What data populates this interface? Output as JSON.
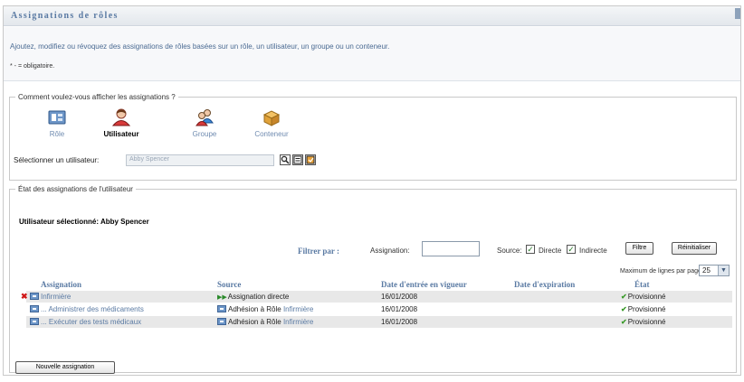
{
  "page": {
    "title": "Assignations de rôles",
    "description": "Ajoutez, modifiez ou révoquez des assignations de rôles basées sur un rôle, un utilisateur, un groupe ou un conteneur.",
    "required_note": "* - = obligatoire."
  },
  "view_section": {
    "legend": "Comment voulez-vous afficher les assignations ?",
    "options": [
      {
        "label": "Rôle",
        "icon": "role-icon",
        "selected": false
      },
      {
        "label": "Utilisateur",
        "icon": "user-icon",
        "selected": true
      },
      {
        "label": "Groupe",
        "icon": "group-icon",
        "selected": false
      },
      {
        "label": "Conteneur",
        "icon": "container-icon",
        "selected": false
      }
    ],
    "select_user_label": "Sélectionner un utilisateur:",
    "select_user_value": "Abby Spencer"
  },
  "status_section": {
    "legend": "État des assignations de l'utilisateur",
    "selected_user": "Utilisateur sélectionné: Abby Spencer",
    "filter_by": "Filtrer par :",
    "assignation_label": "Assignation:",
    "source_label": "Source:",
    "direct_label": "Directe",
    "indirect_label": "Indirecte",
    "filter_button": "Filtre",
    "reset_button": "Réinitialiser",
    "max_rows_label": "Maximum de lignes par page",
    "max_rows_value": "25",
    "columns": [
      "Assignation",
      "Source",
      "Date d'entrée en vigueur",
      "Date d'expiration",
      "État"
    ],
    "rows": [
      {
        "assignment": "Infirmière",
        "source_prefix": "Assignation directe",
        "source_link": "",
        "date": "16/01/2008",
        "expiry": "",
        "status": "Provisionné"
      },
      {
        "assignment": "... Administrer des médicaments",
        "source_prefix": "Adhésion à Rôle",
        "source_link": "Infirmière",
        "date": "16/01/2008",
        "expiry": "",
        "status": "Provisionné"
      },
      {
        "assignment": "... Exécuter des tests médicaux",
        "source_prefix": "Adhésion à Rôle",
        "source_link": "Infirmière",
        "date": "16/01/2008",
        "expiry": "",
        "status": "Provisionné"
      }
    ],
    "new_assignment_button": "Nouvelle assignation"
  },
  "colors": {
    "accent": "#5a7aa3",
    "link": "#5a7aa3",
    "ok_green": "#3a9a2a",
    "delete_red": "#d01818"
  }
}
